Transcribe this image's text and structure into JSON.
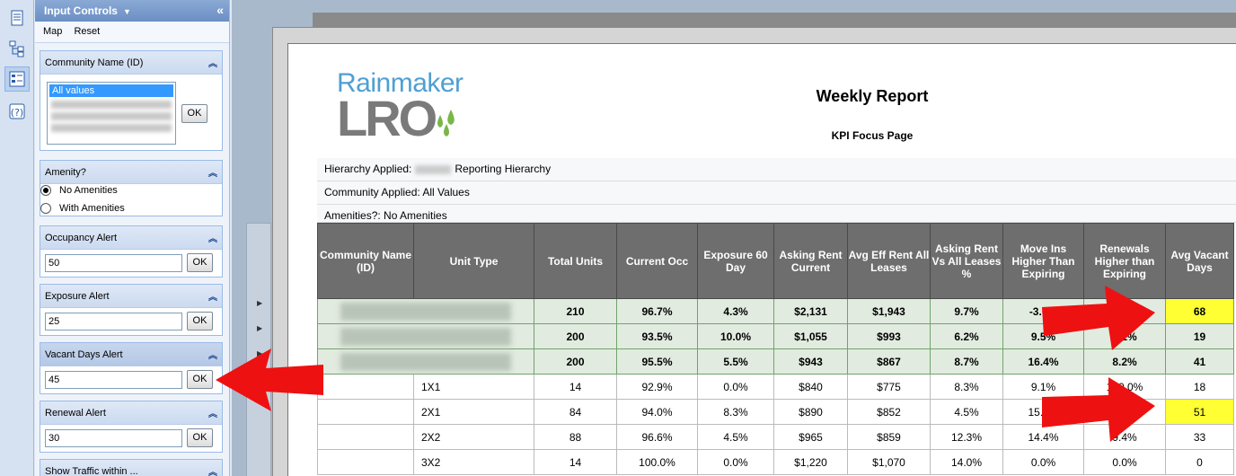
{
  "panel": {
    "title": "Input Controls",
    "menu": [
      "Map",
      "Reset"
    ],
    "controls": {
      "community": {
        "label": "Community Name (ID)",
        "selected": "All values",
        "ok": "OK"
      },
      "amenity": {
        "label": "Amenity?",
        "options": [
          "No Amenities",
          "With Amenities"
        ],
        "selected": "No Amenities"
      },
      "occupancy": {
        "label": "Occupancy Alert",
        "value": "50",
        "ok": "OK"
      },
      "exposure": {
        "label": "Exposure Alert",
        "value": "25",
        "ok": "OK"
      },
      "vacant": {
        "label": "Vacant Days Alert",
        "value": "45",
        "ok": "OK"
      },
      "renewal": {
        "label": "Renewal Alert",
        "value": "30",
        "ok": "OK"
      },
      "traffic": {
        "label": "Show Traffic within ..."
      }
    }
  },
  "report": {
    "logo_top": "Rainmaker",
    "logo_bottom": "LRO",
    "title": "Weekly Report",
    "subtitle": "KPI Focus Page",
    "hierarchy_label": "Hierarchy Applied:",
    "hierarchy_value": "Reporting Hierarchy",
    "community_applied": "Community Applied: All Values",
    "amenities_applied": "Amenities?: No Amenities"
  },
  "table": {
    "headers": [
      "Community Name (ID)",
      "Unit Type",
      "Total Units",
      "Current Occ",
      "Exposure 60 Day",
      "Asking Rent Current",
      "Avg Eff Rent All Leases",
      "Asking Rent Vs All Leases %",
      "Move Ins Higher Than Expiring",
      "Renewals Higher than Expiring",
      "Avg Vacant Days"
    ],
    "summary_rows": [
      [
        "210",
        "96.7%",
        "4.3%",
        "$2,131",
        "$1,943",
        "9.7%",
        "-3.6%",
        "",
        "68"
      ],
      [
        "200",
        "93.5%",
        "10.0%",
        "$1,055",
        "$993",
        "6.2%",
        "9.5%",
        "0.1%",
        "19"
      ],
      [
        "200",
        "95.5%",
        "5.5%",
        "$943",
        "$867",
        "8.7%",
        "16.4%",
        "8.2%",
        "41"
      ]
    ],
    "detail_rows": [
      [
        "1X1",
        "14",
        "92.9%",
        "0.0%",
        "$840",
        "$775",
        "8.3%",
        "9.1%",
        "100.0%",
        "18"
      ],
      [
        "2X1",
        "84",
        "94.0%",
        "8.3%",
        "$890",
        "$852",
        "4.5%",
        "15.8%",
        "",
        "51"
      ],
      [
        "2X2",
        "88",
        "96.6%",
        "4.5%",
        "$965",
        "$859",
        "12.3%",
        "14.4%",
        "9.4%",
        "33"
      ],
      [
        "3X2",
        "14",
        "100.0%",
        "0.0%",
        "$1,220",
        "$1,070",
        "14.0%",
        "0.0%",
        "0.0%",
        "0"
      ]
    ]
  },
  "colors": {
    "highlight": "#ffff33",
    "arrow": "#ee1111",
    "summary_bg": "#e2ebe0"
  },
  "icons": [
    "report-icon",
    "tree-icon",
    "input-controls-icon",
    "help-icon"
  ]
}
